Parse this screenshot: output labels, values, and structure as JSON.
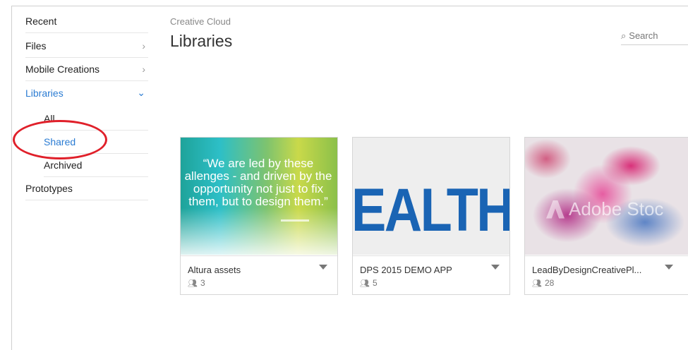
{
  "sidebar": {
    "items": [
      {
        "label": "Recent",
        "chevron": ""
      },
      {
        "label": "Files",
        "chevron": "›"
      },
      {
        "label": "Mobile Creations",
        "chevron": "›"
      },
      {
        "label": "Libraries",
        "chevron": "⌄"
      },
      {
        "label": "Prototypes",
        "chevron": ""
      }
    ],
    "sub_items": [
      {
        "label": "All"
      },
      {
        "label": "Shared"
      },
      {
        "label": "Archived"
      }
    ]
  },
  "header": {
    "breadcrumb": "Creative Cloud",
    "title": "Libraries"
  },
  "search": {
    "placeholder": "Search",
    "icon": "search-icon"
  },
  "colors": {
    "accent": "#2b7cd3",
    "highlight_circle": "#e0202a"
  },
  "cards": [
    {
      "name": "Altura assets",
      "members": "3",
      "thumb_text": "“We are led by these\nallenges - and driven by the\nopportunity not just to fix\nthem, but to design them.”"
    },
    {
      "name": "DPS 2015 DEMO APP",
      "members": "5",
      "thumb_text": "EALTH"
    },
    {
      "name": "LeadByDesignCreativePl...",
      "members": "28",
      "thumb_text": "Adobe Stoc"
    }
  ]
}
